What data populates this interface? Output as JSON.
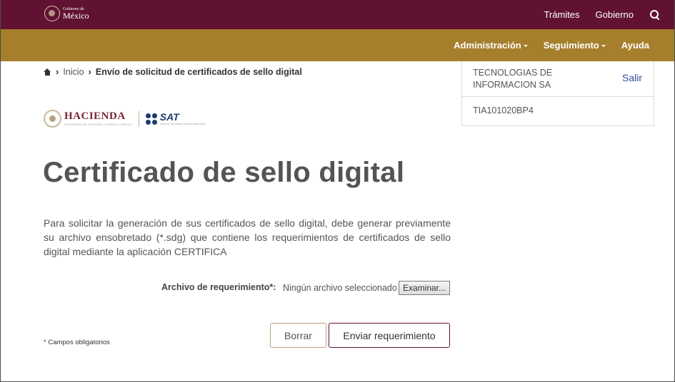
{
  "header": {
    "logo": {
      "small": "Gobierno de",
      "big": "México"
    },
    "nav": [
      "Trámites",
      "Gobierno"
    ],
    "search_icon": "search-icon",
    "colors": {
      "primary": "#611232",
      "gold": "#a57f2c"
    }
  },
  "subnav": {
    "items": [
      "Administración",
      "Seguimiento",
      "Ayuda"
    ]
  },
  "breadcrumb": {
    "home_icon": "home-icon",
    "items": [
      "Inicio",
      "Envío de solicitud de certificados de sello digital"
    ]
  },
  "user": {
    "company": "TECNOLOGIAS DE INFORMACION SA",
    "logout": "Salir",
    "rfc": "TIA101020BP4"
  },
  "logos": {
    "hacienda": "HACIENDA",
    "hacienda_sub": "SECRETARÍA DE HACIENDA Y CRÉDITO PÚBLICO",
    "sat": "SAT",
    "sat_sub": "SERVICIO DE ADMINISTRACIÓN TRIBUTARIA"
  },
  "main": {
    "title": "Certificado de sello digital",
    "description": "Para solicitar la generación de sus certificados de sello digital, debe generar previamente su archivo ensobretado (*.sdg) que contiene los requerimientos de certificados de sello digital mediante la aplicación CERTIFICA",
    "file_label": "Archivo de requerimiento*:",
    "file_status": "Ningún archivo seleccionado",
    "file_button": "Examinar...",
    "required_note": "* Campos obligatorios",
    "clear_button": "Borrar",
    "submit_button": "Enviar requerimiento"
  }
}
